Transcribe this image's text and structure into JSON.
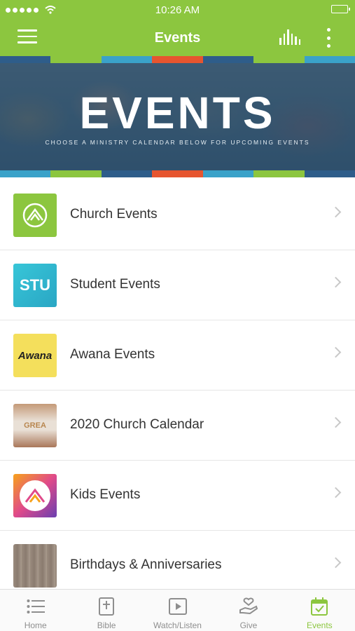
{
  "status_bar": {
    "time": "10:26 AM"
  },
  "nav": {
    "title": "Events"
  },
  "colors": {
    "accent": "#8cc63f",
    "stripes": [
      "#2e5d8a",
      "#8cc63f",
      "#3aa2c9",
      "#e6552f",
      "#2e5d8a",
      "#8cc63f",
      "#3aa2c9"
    ]
  },
  "banner": {
    "heading": "EVENTS",
    "subheading": "CHOOSE A MINISTRY CALENDAR BELOW FOR UPCOMING EVENTS"
  },
  "events": [
    {
      "label": "Church Events",
      "thumb_text": "",
      "thumb_color": "#8cc63f"
    },
    {
      "label": "Student Events",
      "thumb_text": "STU",
      "thumb_color": "#37c6d8"
    },
    {
      "label": "Awana Events",
      "thumb_text": "Awana",
      "thumb_color": "#f2d84b"
    },
    {
      "label": "2020 Church Calendar",
      "thumb_text": "GREA",
      "thumb_color": "#b5835f"
    },
    {
      "label": "Kids Events",
      "thumb_text": "",
      "thumb_color": "#e04a8a"
    },
    {
      "label": "Birthdays & Anniversaries",
      "thumb_text": "",
      "thumb_color": "#8d7e72"
    }
  ],
  "tabs": [
    {
      "label": "Home",
      "icon": "list-icon"
    },
    {
      "label": "Bible",
      "icon": "bible-icon"
    },
    {
      "label": "Watch/Listen",
      "icon": "play-icon"
    },
    {
      "label": "Give",
      "icon": "give-hand-icon"
    },
    {
      "label": "Events",
      "icon": "calendar-check-icon"
    }
  ]
}
